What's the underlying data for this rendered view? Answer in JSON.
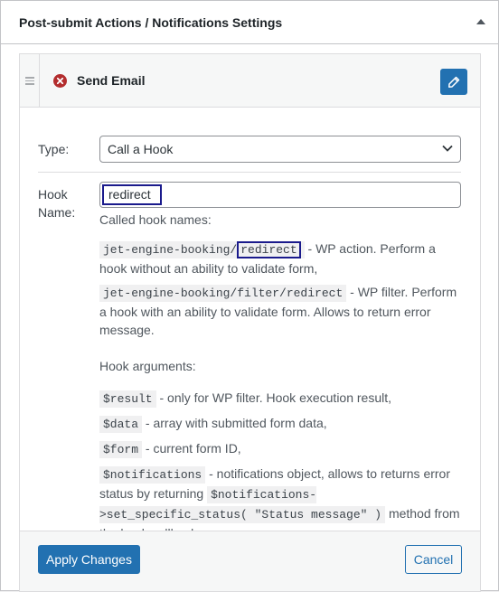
{
  "panel": {
    "title": "Post-submit Actions / Notifications Settings",
    "toggle_icon": "triangle-up-icon"
  },
  "action": {
    "title": "Send Email",
    "delete_icon": "close-circle-icon",
    "edit_icon": "pencil-icon"
  },
  "form": {
    "type_label": "Type:",
    "type_value": "Call a Hook",
    "hook_label_line1": "Hook",
    "hook_label_line2": "Name:",
    "hook_value": "redirect"
  },
  "help": {
    "called_hook_names": "Called hook names:",
    "action_code_prefix": "jet-engine-booking/",
    "action_code_highlight": "redirect",
    "action_desc": " - WP action. Perform a hook without an ability to validate form,",
    "filter_code": "jet-engine-booking/filter/redirect",
    "filter_desc": " - WP filter. Perform a hook with an ability to validate form. Allows to return error message.",
    "hook_arguments": "Hook arguments:",
    "args": [
      {
        "code": "$result",
        "desc": " - only for WP filter. Hook execution result,"
      },
      {
        "code": "$data",
        "desc": " - array with submitted form data,"
      },
      {
        "code": "$form",
        "desc": " - current form ID,"
      }
    ],
    "notifications_code": "$notifications",
    "notifications_desc": " - notifications object, allows to returns error status by returning ",
    "notifications_method": "$notifications->set_specific_status( \"Status message\" )",
    "notifications_tail": " method from the hook callback."
  },
  "footer": {
    "apply_label": "Apply Changes",
    "cancel_label": "Cancel"
  },
  "colors": {
    "primary": "#2271b1",
    "delete": "#b32d2e",
    "highlight_border": "#1a1a8c"
  }
}
